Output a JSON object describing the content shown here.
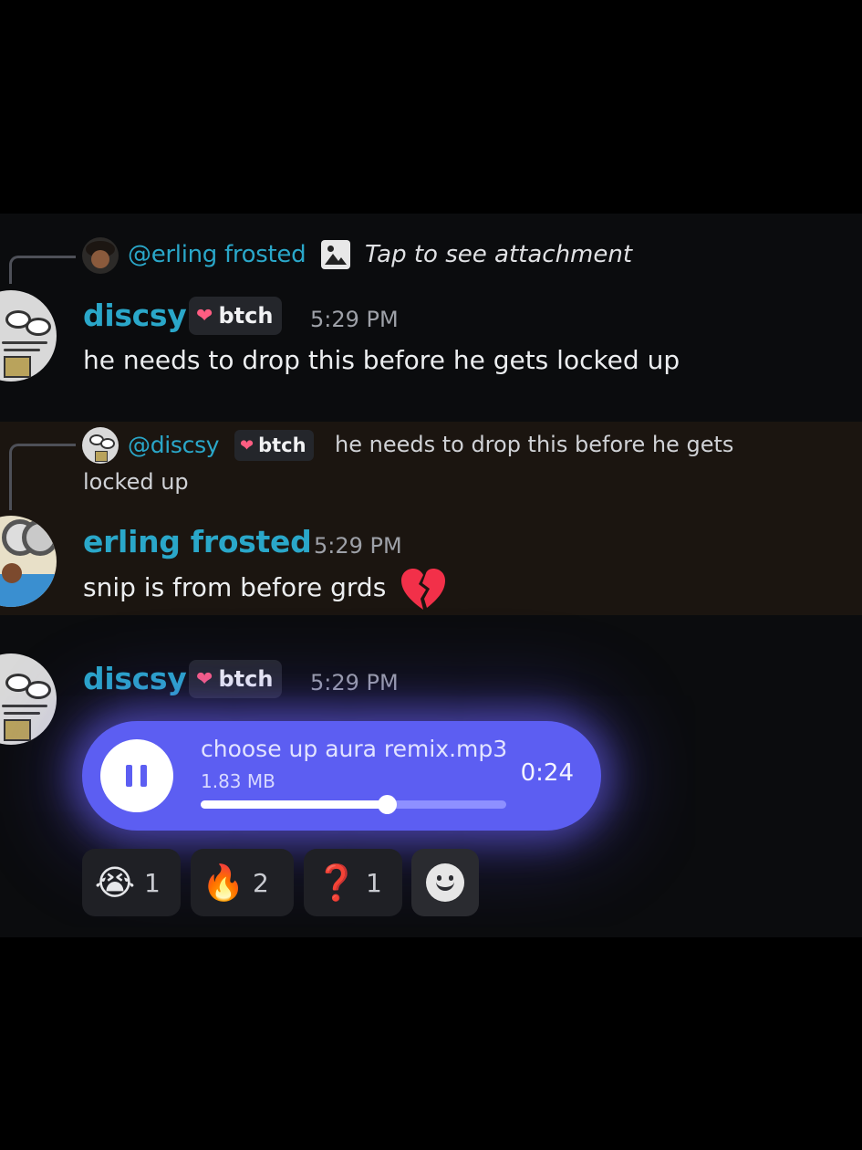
{
  "messages": [
    {
      "reply": {
        "username": "@erling frosted",
        "text": "Tap to see attachment"
      },
      "username": "discsy",
      "badge": "btch",
      "time": "5:29 PM",
      "text": "he needs to drop this before he gets locked up"
    },
    {
      "reply": {
        "username": "@discsy",
        "badge": "btch",
        "text_line1": "he needs to drop this before he gets",
        "text_line2": "locked up"
      },
      "username": "erling frosted",
      "time": "5:29 PM",
      "text": "snip is from before grds",
      "emoji": "broken-heart"
    },
    {
      "username": "discsy",
      "badge": "btch",
      "time": "5:29 PM",
      "audio": {
        "filename": "choose up aura remix.mp3",
        "size": "1.83 MB",
        "duration": "0:24",
        "state": "playing",
        "progress": 0.61
      },
      "reactions": [
        {
          "emoji": "😭",
          "count": "1"
        },
        {
          "emoji": "🔥",
          "count": "2"
        },
        {
          "emoji": "❓",
          "count": "1"
        }
      ]
    }
  ],
  "colors": {
    "username": "#2aa7c9",
    "audio_bubble": "#5c5ef2",
    "highlight_bg": "#1b1510",
    "badge_heart": "#ff5d82"
  }
}
